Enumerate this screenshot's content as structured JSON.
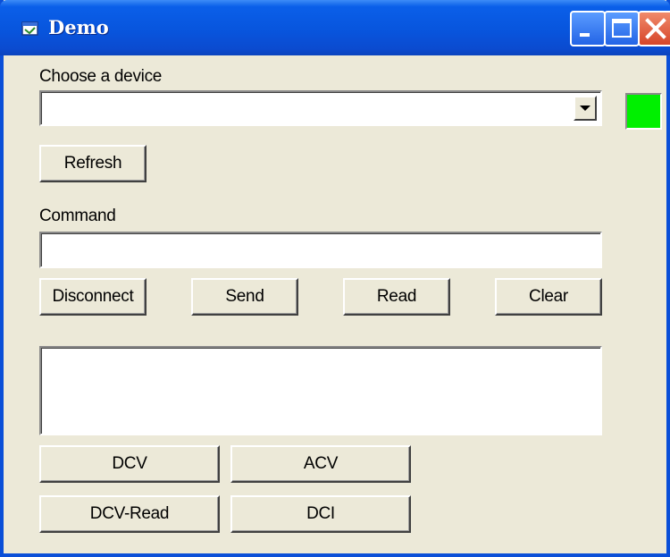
{
  "window": {
    "title": "Demo",
    "icon": "app-window-icon"
  },
  "device": {
    "label": "Choose a device",
    "selected": "",
    "status_color": "#00f000"
  },
  "buttons": {
    "refresh": "Refresh",
    "disconnect": "Disconnect",
    "send": "Send",
    "read": "Read",
    "clear": "Clear",
    "dcv": "DCV",
    "acv": "ACV",
    "dcv_read": "DCV-Read",
    "dci": "DCI"
  },
  "command": {
    "label": "Command",
    "value": ""
  },
  "output": {
    "value": ""
  }
}
